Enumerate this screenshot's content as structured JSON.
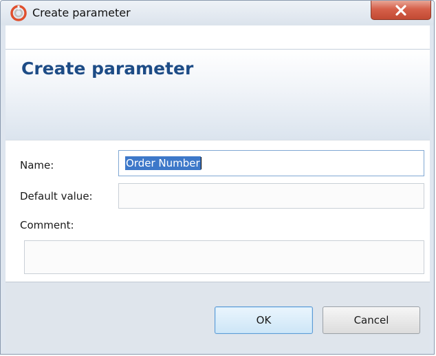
{
  "window": {
    "title": "Create parameter",
    "icon": "app-logo-icon",
    "close_icon": "close-icon",
    "accent_color": "#1d4c86",
    "close_color": "#d6604a"
  },
  "header": {
    "title": "Create parameter"
  },
  "form": {
    "name_label": "Name:",
    "name_value": "Order Number",
    "default_label": "Default value:",
    "default_value": "",
    "comment_label": "Comment:",
    "comment_value": ""
  },
  "footer": {
    "ok_label": "OK",
    "cancel_label": "Cancel"
  }
}
